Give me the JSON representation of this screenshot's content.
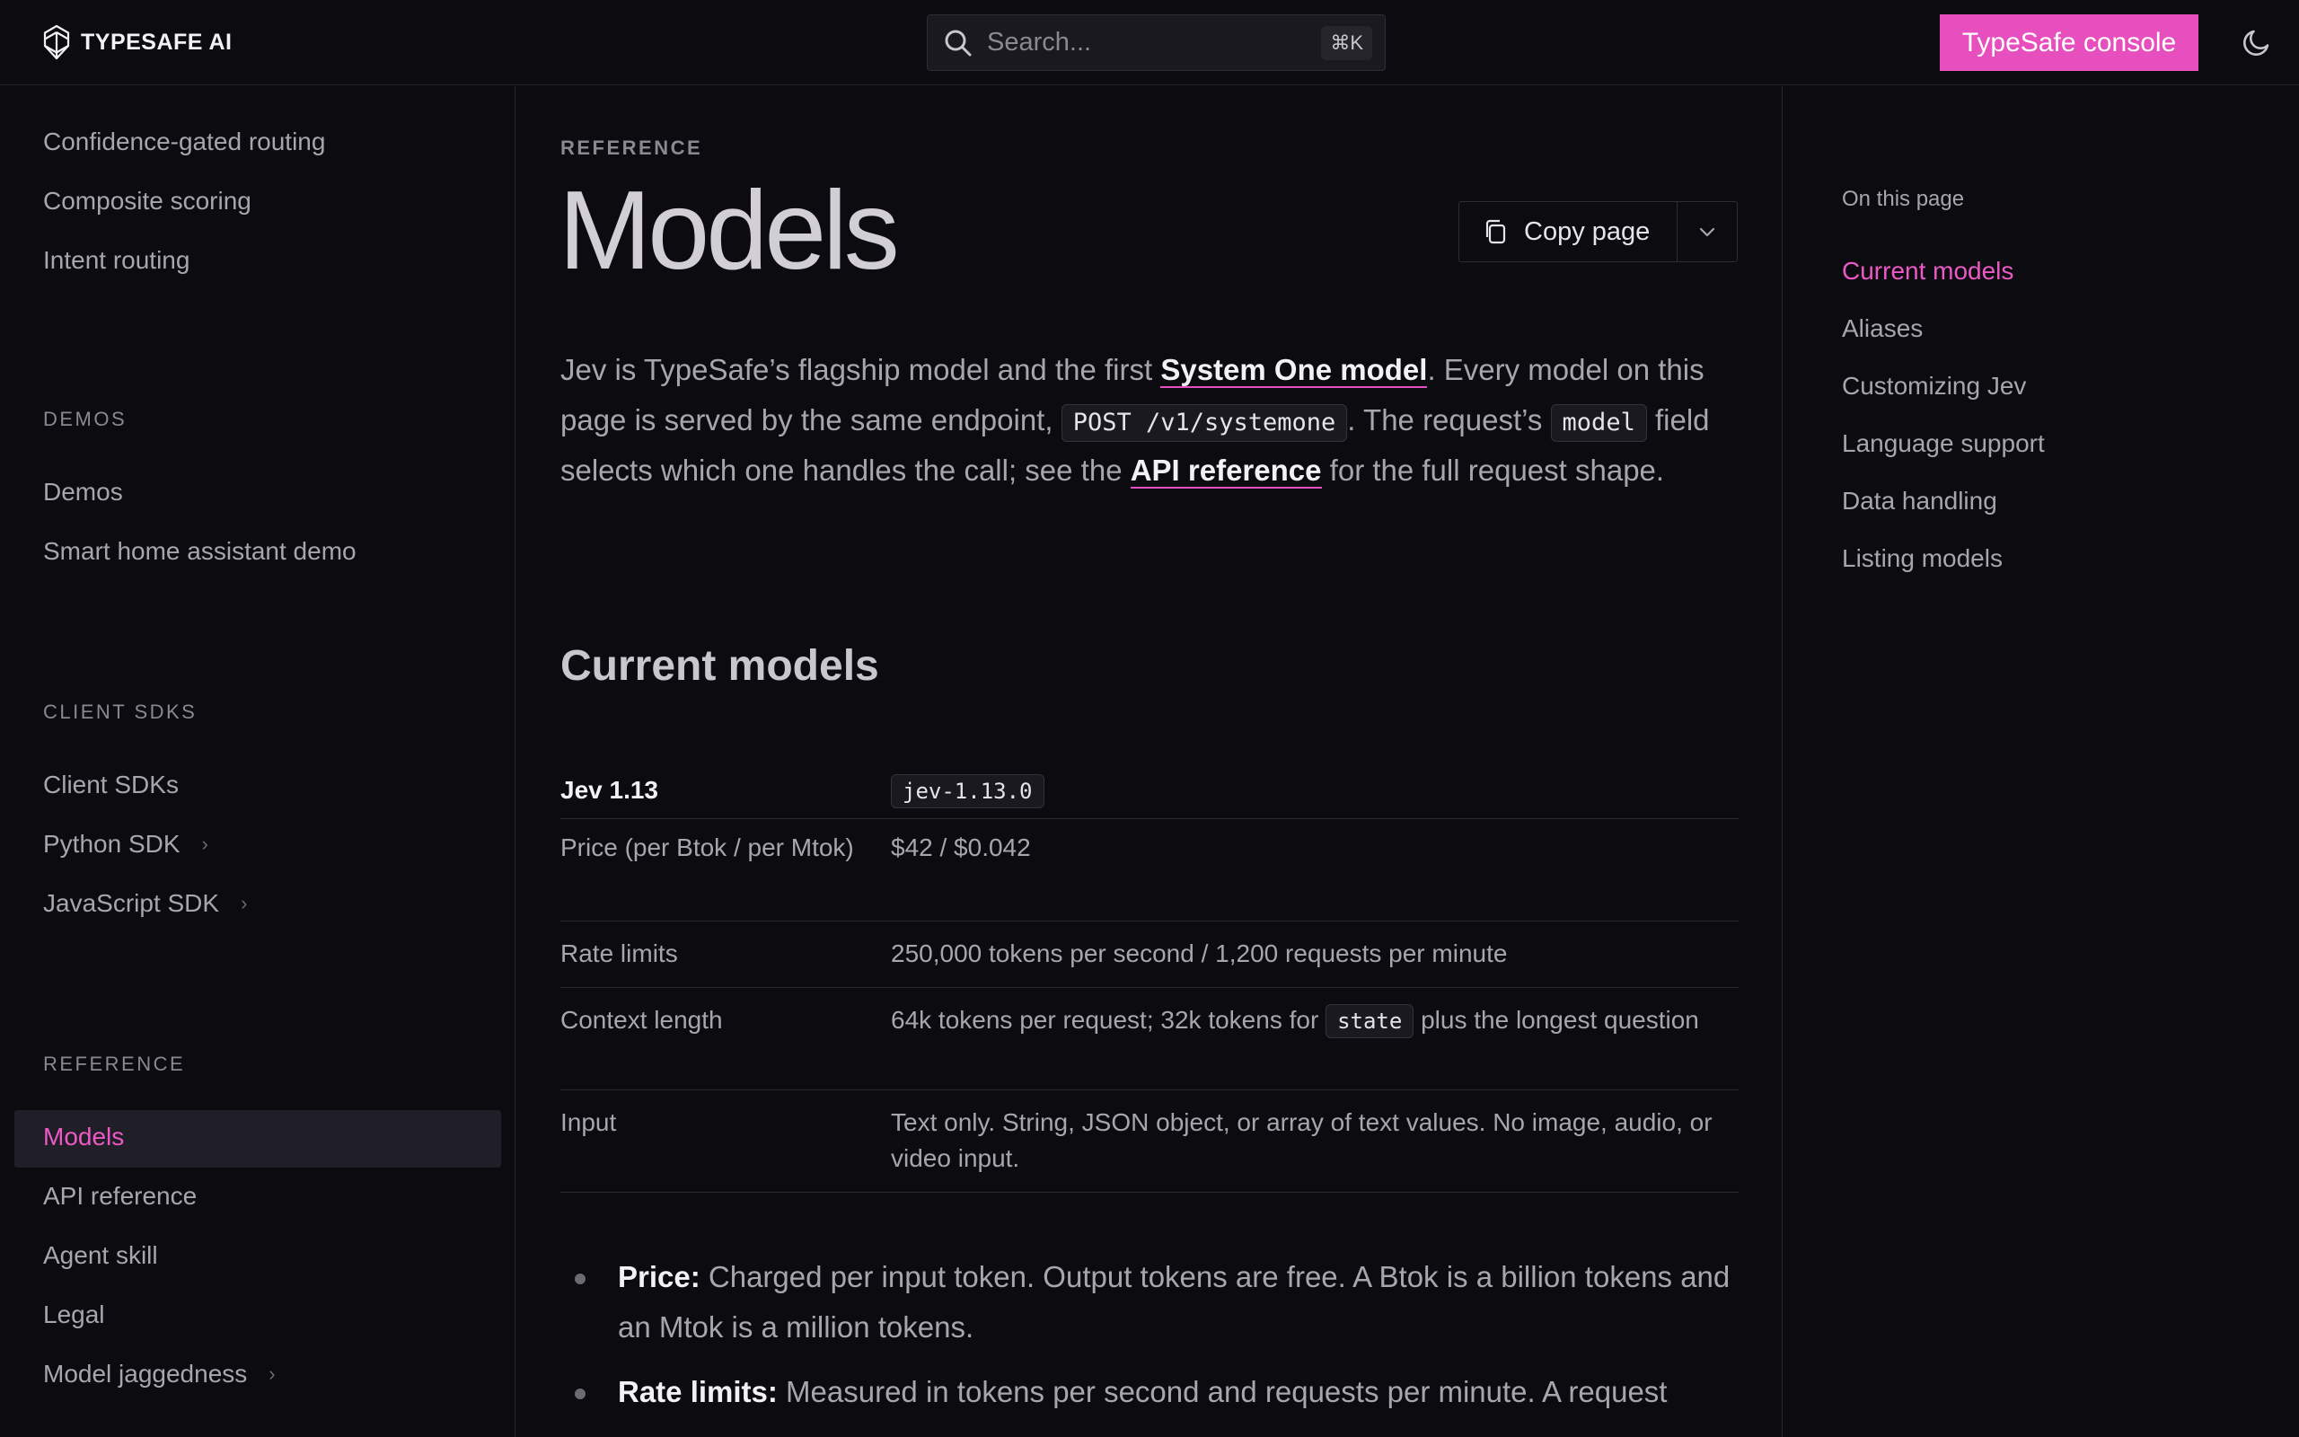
{
  "header": {
    "logo_text": "TYPESAFE AI",
    "search_placeholder": "Search...",
    "search_shortcut": "⌘K",
    "console_button": "TypeSafe console",
    "theme_icon": "moon-icon",
    "accent_color": "#e64fbd"
  },
  "sidebar": {
    "top_items": [
      "Confidence-gated routing",
      "Composite scoring",
      "Intent routing"
    ],
    "demos_heading": "DEMOS",
    "demos_items": [
      "Demos",
      "Smart home assistant demo"
    ],
    "sdks_heading": "CLIENT SDKS",
    "sdks_items": [
      "Client SDKs",
      "Python SDK",
      "JavaScript SDK"
    ],
    "reference_heading": "REFERENCE",
    "reference_items": [
      "Models",
      "API reference",
      "Agent skill",
      "Legal",
      "Model jaggedness"
    ],
    "active_item": "Models"
  },
  "main": {
    "eyebrow": "REFERENCE",
    "title": "Models",
    "copy_label": "Copy page",
    "intro": {
      "p1": "Jev is TypeSafe’s flagship model and the first ",
      "link1": "System One model",
      "p2": ". Every model on this page is served by the same endpoint, ",
      "code1": "POST /v1/systemone",
      "p3": ". The request’s ",
      "code2": "model",
      "p4": " field selects which one handles the call; see the ",
      "link2": "API reference",
      "p5": " for the full request shape."
    },
    "section_title": "Current models",
    "spec": {
      "model_name": "Jev 1.13",
      "model_id": "jev-1.13.0",
      "rows": [
        {
          "key": "Price (per Btok / per Mtok)",
          "value": "$42 / $0.042"
        },
        {
          "key": "Rate limits",
          "value": "250,000 tokens per second / 1,200 requests per minute"
        },
        {
          "key": "Context length",
          "value_a": "64k tokens per request; 32k tokens for ",
          "value_code": "state",
          "value_b": " plus the longest question"
        },
        {
          "key": "Input",
          "value": "Text only. String, JSON object, or array of text values. No image, audio, or video input."
        }
      ]
    },
    "bullets": [
      {
        "label": "Price:",
        "text": " Charged per input token. Output tokens are free. A Btok is a billion tokens and an Mtok is a million tokens."
      },
      {
        "label": "Rate limits:",
        "text": " Measured in tokens per second and requests per minute. A request"
      }
    ]
  },
  "toc": {
    "heading": "On this page",
    "items": [
      "Current models",
      "Aliases",
      "Customizing Jev",
      "Language support",
      "Data handling",
      "Listing models"
    ],
    "active_item": "Current models"
  }
}
